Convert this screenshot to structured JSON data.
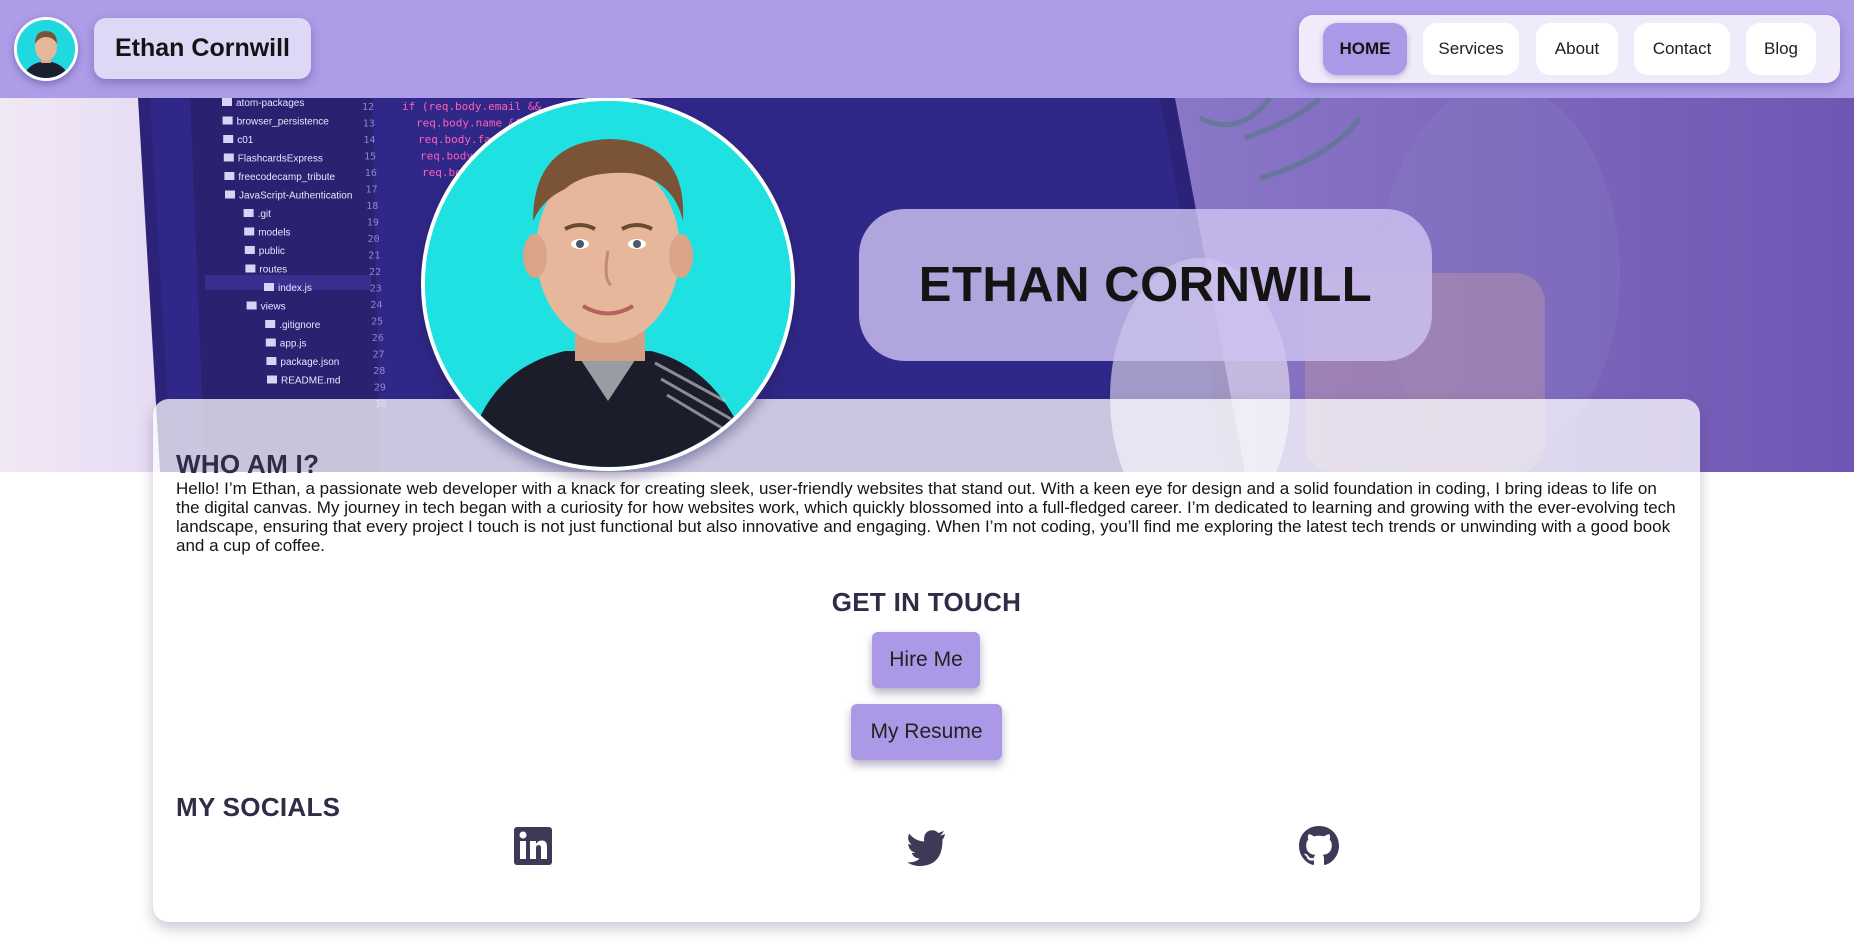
{
  "nav": {
    "brand": "Ethan Cornwill",
    "links": [
      {
        "label": "HOME",
        "active": true
      },
      {
        "label": "Services",
        "active": false
      },
      {
        "label": "About",
        "active": false
      },
      {
        "label": "Contact",
        "active": false
      },
      {
        "label": "Blog",
        "active": false
      }
    ]
  },
  "hero": {
    "title": "ETHAN CORNWILL",
    "background": {
      "file_tree": [
        "atom-packages",
        "browser_persistence",
        "c01",
        "FlashcardsExpress",
        "freecodecamp_tribute",
        "JavaScript-Authentication",
        ".git",
        "models",
        "public",
        "routes",
        "index.js",
        "views",
        ".gitignore",
        "app.js",
        "package.json",
        "README.md"
      ],
      "line_numbers": [
        "12",
        "13",
        "14",
        "15",
        "16",
        "17",
        "18",
        "19",
        "20",
        "21",
        "22",
        "23",
        "24",
        "25",
        "26",
        "27",
        "28",
        "29",
        "30"
      ],
      "code_lines": [
        "if (req.body.email &&",
        "req.body.name &&",
        "req.body.fav",
        "req.body",
        "req.bo"
      ]
    }
  },
  "about": {
    "heading": "WHO AM I?",
    "text": "Hello! I’m Ethan, a passionate web developer with a knack for creating sleek, user-friendly websites that stand out. With a keen eye for design and a solid foundation in coding, I bring ideas to life on the digital canvas. My journey in tech began with a curiosity for how websites work, which quickly blossomed into a full-fledged career. I’m dedicated to learning and growing with the ever-evolving tech landscape, ensuring that every project I touch is not just functional but also innovative and engaging. When I’m not coding, you’ll find me exploring the latest tech trends or unwinding with a good book and a cup of coffee."
  },
  "contact": {
    "heading": "GET IN TOUCH",
    "hire_label": "Hire Me",
    "resume_label": "My Resume"
  },
  "socials": {
    "heading": "MY SOCIALS",
    "items": [
      "linkedin-icon",
      "twitter-icon",
      "github-icon"
    ]
  },
  "colors": {
    "accent": "#ad9de9",
    "button": "#ab99e8",
    "heading": "#2f2c47",
    "portrait_bg": "#1fe1e2"
  }
}
